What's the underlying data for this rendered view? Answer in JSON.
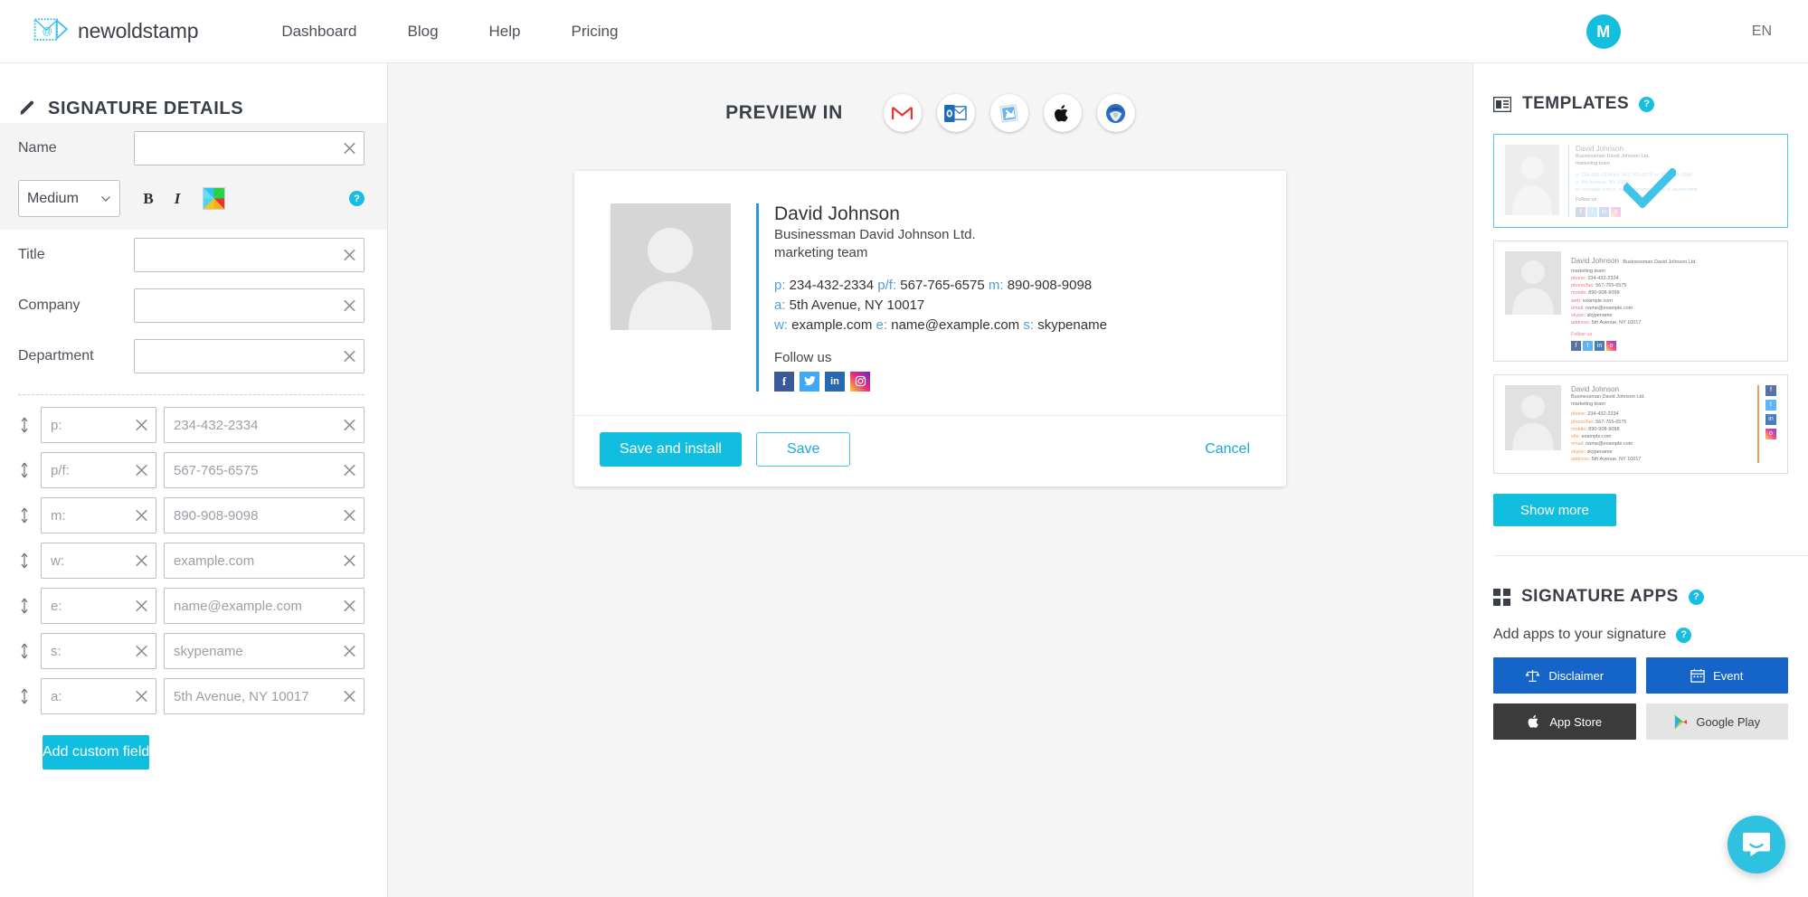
{
  "header": {
    "brand": "newoldstamp",
    "logo_icon": "envelope-at-logo-icon",
    "nav": [
      {
        "label": "Dashboard"
      },
      {
        "label": "Blog"
      },
      {
        "label": "Help"
      },
      {
        "label": "Pricing"
      }
    ],
    "avatar_initial": "M",
    "language": "EN",
    "accent_color": "#14bfdd"
  },
  "left_panel": {
    "title": "SIGNATURE DETAILS",
    "title_icon": "pen-icon",
    "fields": [
      {
        "label": "Name",
        "value": "",
        "placeholder": ""
      },
      {
        "label": "Title",
        "value": "",
        "placeholder": ""
      },
      {
        "label": "Company",
        "value": "",
        "placeholder": ""
      },
      {
        "label": "Department",
        "value": "",
        "placeholder": ""
      }
    ],
    "style_row": {
      "size_selected": "Medium",
      "bold_label": "B",
      "italic_label": "I",
      "color_picker_icon": "color-wheel-icon",
      "help_label": "?"
    },
    "contact_rows": [
      {
        "key_placeholder": "p:",
        "value_placeholder": "234-432-2334"
      },
      {
        "key_placeholder": "p/f:",
        "value_placeholder": "567-765-6575"
      },
      {
        "key_placeholder": "m:",
        "value_placeholder": "890-908-9098"
      },
      {
        "key_placeholder": "w:",
        "value_placeholder": "example.com"
      },
      {
        "key_placeholder": "e:",
        "value_placeholder": "name@example.com"
      },
      {
        "key_placeholder": "s:",
        "value_placeholder": "skypename"
      },
      {
        "key_placeholder": "a:",
        "value_placeholder": "5th Avenue, NY 10017"
      }
    ],
    "add_custom_field": "Add custom field"
  },
  "center_panel": {
    "preview_label": "PREVIEW IN",
    "clients": [
      {
        "name": "gmail-icon",
        "title": "Gmail"
      },
      {
        "name": "outlook-icon",
        "title": "Outlook"
      },
      {
        "name": "apple-mail-icon",
        "title": "Apple Mail"
      },
      {
        "name": "apple-icon",
        "title": "Apple"
      },
      {
        "name": "thunderbird-icon",
        "title": "Thunderbird"
      }
    ],
    "signature": {
      "name": "David Johnson",
      "company_line": "Businessman David Johnson Ltd.",
      "department_line": "marketing team",
      "contacts": [
        [
          {
            "label": "p:",
            "value": "234-432-2334"
          },
          {
            "label": "p/f:",
            "value": "567-765-6575"
          },
          {
            "label": "m:",
            "value": "890-908-9098"
          }
        ],
        [
          {
            "label": "a:",
            "value": "5th Avenue, NY 10017"
          }
        ],
        [
          {
            "label": "w:",
            "value": "example.com"
          },
          {
            "label": "e:",
            "value": "name@example.com"
          },
          {
            "label": "s:",
            "value": "skypename"
          }
        ]
      ],
      "follow_us": "Follow us",
      "socials": [
        "facebook",
        "twitter",
        "linkedin",
        "instagram"
      ],
      "accent_bar_color": "#2d97de"
    },
    "buttons": {
      "save_install": "Save and install",
      "save": "Save",
      "cancel": "Cancel"
    }
  },
  "right_panel": {
    "templates_title": "TEMPLATES",
    "templates_icon": "template-layout-icon",
    "templates": [
      {
        "selected": true,
        "layout": "inline",
        "name": "David Johnson",
        "company": "Businessman David Johnson Ltd.",
        "department": "marketing team",
        "lines": [
          "p: 234-432-2334  p/f: 567-765-6575  m: 890-908-9098",
          "a: 5th Avenue, NY 10017",
          "w: example.com  e: name@example.com  s: skypename"
        ],
        "follow_us": "Follow us",
        "label_color": "#9fc4e0"
      },
      {
        "selected": false,
        "layout": "labeled",
        "name": "David Johnson",
        "company": "Businessman David Johnson Ltd.",
        "department": "marketing team",
        "pairs": [
          {
            "label": "phone:",
            "value": "234-432-2334"
          },
          {
            "label": "phone/fax:",
            "value": "567-765-6575"
          },
          {
            "label": "mobile:",
            "value": "890-908-9098"
          },
          {
            "label": "web:",
            "value": "example.com"
          },
          {
            "label": "email:",
            "value": "name@example.com"
          },
          {
            "label": "skype:",
            "value": "skypename"
          },
          {
            "label": "address:",
            "value": "5th Avenue, NY 10017"
          }
        ],
        "follow_us": "Follow us",
        "label_color": "#e8607a"
      },
      {
        "selected": false,
        "layout": "side-social",
        "name": "David Johnson",
        "company": "Businessman David Johnson Ltd.",
        "department": "marketing team",
        "pairs": [
          {
            "label": "phone:",
            "value": "234-432-2334"
          },
          {
            "label": "phone/fax:",
            "value": "567-765-6575"
          },
          {
            "label": "mobile:",
            "value": "890-908-9098"
          },
          {
            "label": "site:",
            "value": "example.com"
          },
          {
            "label": "email:",
            "value": "name@example.com"
          },
          {
            "label": "skype:",
            "value": "skypename"
          },
          {
            "label": "address:",
            "value": "5th Avenue, NY 10017"
          }
        ],
        "label_color": "#f08a3c"
      }
    ],
    "show_more": "Show more",
    "apps_title": "SIGNATURE APPS",
    "apps_icon": "grid-squares-icon",
    "apps_subtitle": "Add apps to your signature",
    "apps": [
      {
        "label": "Disclaimer",
        "icon": "scales-icon",
        "style": "blue"
      },
      {
        "label": "Event",
        "icon": "calendar-icon",
        "style": "blue"
      },
      {
        "label": "App Store",
        "icon": "apple-icon",
        "style": "dark"
      },
      {
        "label": "Google Play",
        "icon": "google-play-icon",
        "style": "grey"
      }
    ],
    "help_label": "?"
  },
  "chat_widget": {
    "icon": "intercom-chat-icon"
  }
}
